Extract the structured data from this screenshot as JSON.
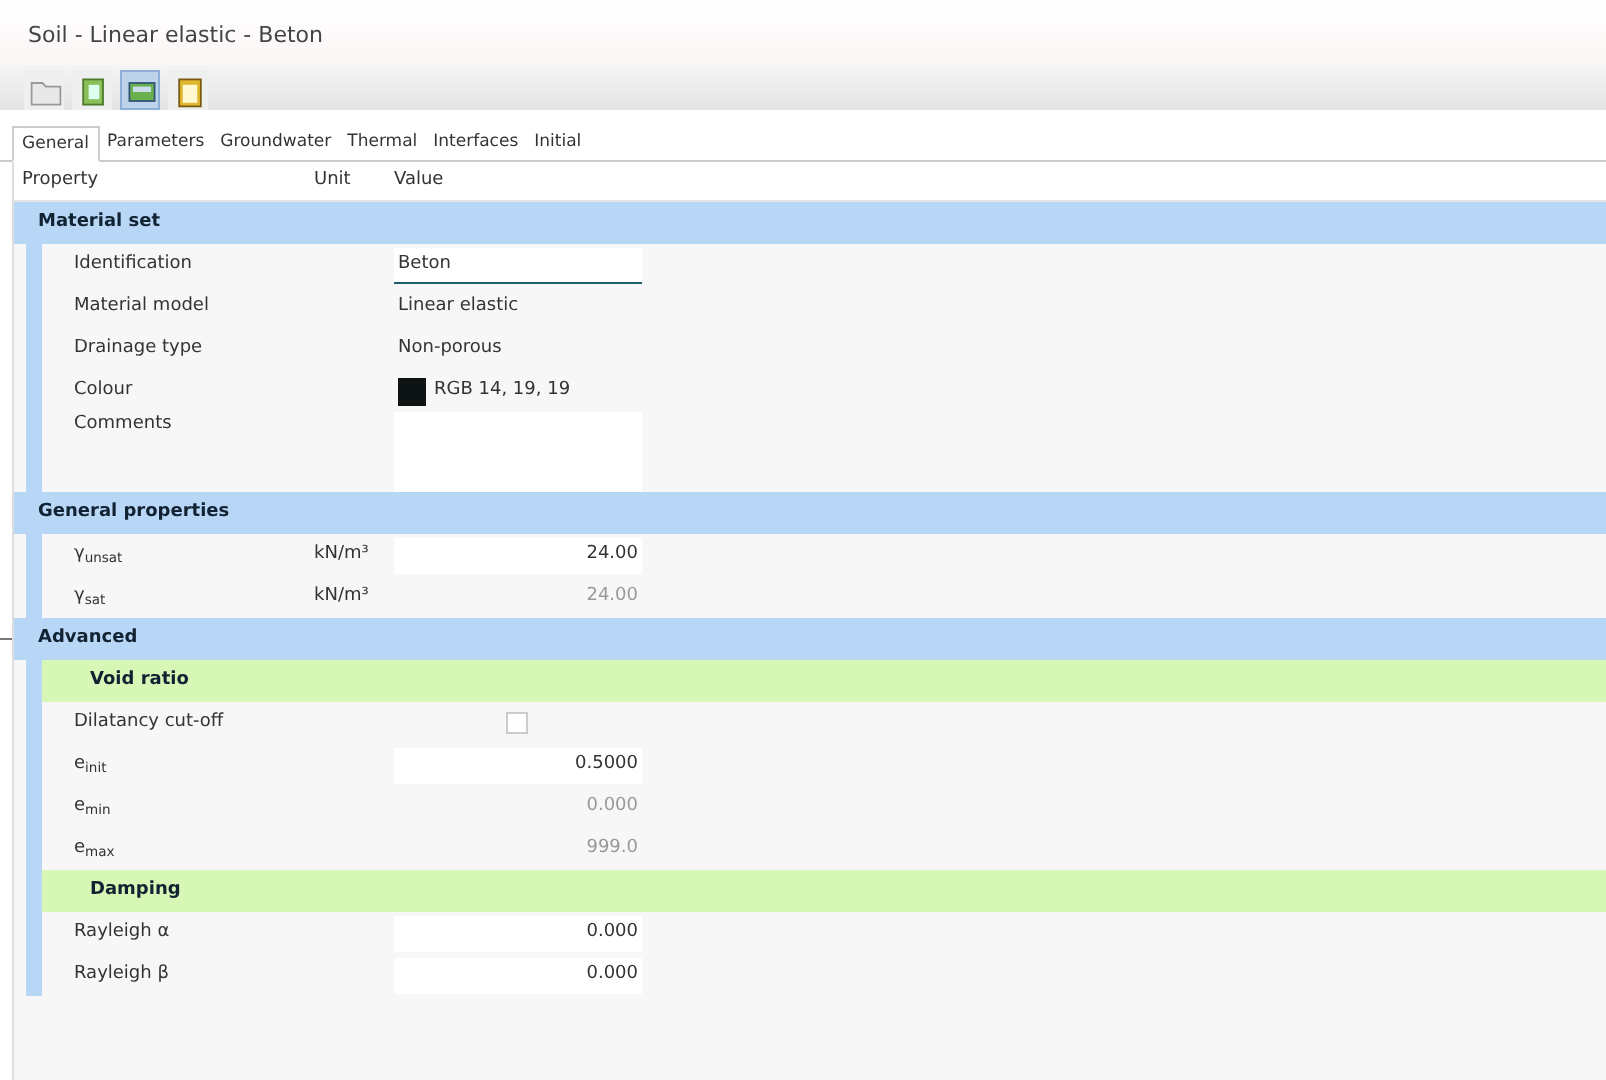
{
  "window": {
    "title": "Soil - Linear elastic - Beton"
  },
  "toolbar": [
    {
      "kind": "open",
      "selected": false
    },
    {
      "kind": "copy",
      "selected": false
    },
    {
      "kind": "view",
      "selected": true
    },
    {
      "kind": "clipboard",
      "selected": false
    }
  ],
  "tabs": [
    {
      "label": "General",
      "selected": true
    },
    {
      "label": "Parameters",
      "selected": false
    },
    {
      "label": "Groundwater",
      "selected": false
    },
    {
      "label": "Thermal",
      "selected": false
    },
    {
      "label": "Interfaces",
      "selected": false
    },
    {
      "label": "Initial",
      "selected": false
    }
  ],
  "columns": [
    "Property",
    "Unit",
    "Value"
  ],
  "sections": [
    {
      "title": "Material set",
      "rows": [
        {
          "kind": "text",
          "label": "Identification",
          "value": "Beton",
          "focused": true
        },
        {
          "kind": "text",
          "label": "Material model",
          "value": "Linear elastic"
        },
        {
          "kind": "text",
          "label": "Drainage type",
          "value": "Non-porous"
        },
        {
          "kind": "color",
          "label": "Colour",
          "value": "RGB 14, 19, 19",
          "color": "#0e1313"
        },
        {
          "kind": "memo",
          "label": "Comments"
        }
      ]
    },
    {
      "title": "General properties",
      "rows": [
        {
          "kind": "number",
          "label": "γ$_{unsat}$",
          "unit": "kN/m³",
          "value": "24.00",
          "disabled": false
        },
        {
          "kind": "number",
          "label": "γ$_{sat}$",
          "unit": "kN/m³",
          "value": "24.00",
          "disabled": true
        }
      ]
    },
    {
      "title": "Advanced",
      "expanded": true,
      "subsections": [
        {
          "title": "Void ratio",
          "rows": [
            {
              "kind": "checkbox",
              "label": "Dilatancy cut-off",
              "checked": false
            },
            {
              "kind": "number",
              "label": "e$_{init}$",
              "value": "0.5000",
              "disabled": false
            },
            {
              "kind": "number",
              "label": "e$_{min}$",
              "value": "0.000",
              "disabled": true
            },
            {
              "kind": "number",
              "label": "e$_{max}$",
              "value": "999.0",
              "disabled": true
            }
          ]
        },
        {
          "title": "Damping",
          "rows": [
            {
              "kind": "number",
              "label": "Rayleigh α",
              "value": "0.000",
              "disabled": false
            },
            {
              "kind": "number",
              "label": "Rayleigh β",
              "value": "0.000",
              "disabled": false
            }
          ]
        }
      ]
    }
  ]
}
